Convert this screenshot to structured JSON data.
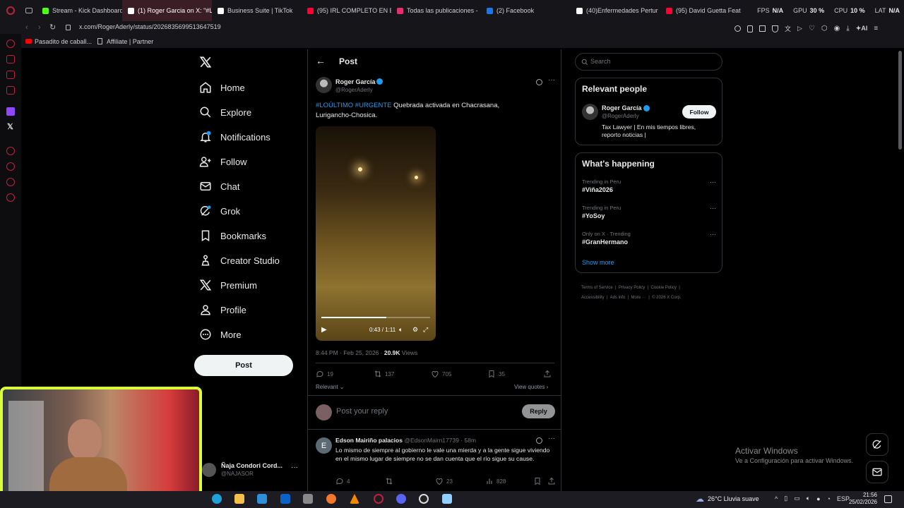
{
  "browser": {
    "tabs": [
      {
        "label": "Stream - Kick Dashboard",
        "color": "#53fc18"
      },
      {
        "label": "(1) Roger Garcia on X: \"#L",
        "color": "#ffffff",
        "active": true
      },
      {
        "label": "Business Suite | TikTok",
        "color": "#ffffff"
      },
      {
        "label": "(95) IRL COMPLETO EN E",
        "color": "#ff0033"
      },
      {
        "label": "Todas las publicaciones -",
        "color": "#e1306c"
      },
      {
        "label": "(2) Facebook",
        "color": "#1877f2"
      },
      {
        "label": "(40)Enfermedades Pertur",
        "color": "#ffffff"
      },
      {
        "label": "(95) David Guetta Feat",
        "color": "#ff0033"
      }
    ],
    "stats": {
      "fps_label": "FPS",
      "fps_value": "N/A",
      "gpu_label": "GPU",
      "gpu_value": "30 %",
      "cpu_label": "CPU",
      "cpu_value": "10 %",
      "lat_label": "LAT",
      "lat_value": "N/A"
    },
    "url": "x.com/RogerAderly/status/2026835699513647519",
    "ai_label": "AI",
    "bookmarks": [
      {
        "label": "Pasadito de caball..."
      },
      {
        "label": "Affiliate | Partner"
      }
    ]
  },
  "nav": {
    "items": [
      {
        "label": "Home",
        "icon": "home-icon"
      },
      {
        "label": "Explore",
        "icon": "search-icon"
      },
      {
        "label": "Notifications",
        "icon": "bell-icon"
      },
      {
        "label": "Follow",
        "icon": "person-plus-icon"
      },
      {
        "label": "Chat",
        "icon": "mail-icon"
      },
      {
        "label": "Grok",
        "icon": "grok-icon"
      },
      {
        "label": "Bookmarks",
        "icon": "bookmark-icon"
      },
      {
        "label": "Creator Studio",
        "icon": "creator-icon"
      },
      {
        "label": "Premium",
        "icon": "x-icon"
      },
      {
        "label": "Profile",
        "icon": "person-icon"
      },
      {
        "label": "More",
        "icon": "more-circle-icon"
      }
    ],
    "post_button": "Post",
    "account": {
      "name": "Ñaja Condori Cord...",
      "handle": "@NAJASOR"
    }
  },
  "post": {
    "header": "Post",
    "author": {
      "name": "Roger García",
      "handle": "@RogerAderly"
    },
    "text_tags": "#LOÚLTIMO #URGENTE",
    "text_body": " Quebrada activada en Chacrasana, Lurigancho-Chosica.",
    "video": {
      "time": "0:43 / 1:11",
      "progress": 0.6
    },
    "timestamp": "8:44 PM · Feb 25, 2026 · ",
    "views_count": "20.9K",
    "views_label": " Views",
    "replies": "19",
    "reposts": "137",
    "likes": "705",
    "bookmarks": "35",
    "sort_label": "Relevant",
    "view_quotes": "View quotes",
    "reply_placeholder": "Post your reply",
    "reply_button": "Reply"
  },
  "reply": {
    "avatar_letter": "E",
    "name": "Edson Mairiño palacios",
    "handle": "@EdsonMairn17739",
    "time": " · 58m",
    "text": "Lo mismo de siempre al gobierno le vale una mierda y a la gente sigue viviendo en el mismo lugar de siempre no se dan cuenta que el río sigue su cause.",
    "replies": "4",
    "likes": "23",
    "views": "828"
  },
  "right": {
    "search_placeholder": "Search",
    "relevant_title": "Relevant people",
    "person": {
      "name": "Roger García",
      "handle": "@RogerAderly",
      "bio": "Tax Lawyer | En mis tiempos libres, reporto noticias |",
      "follow": "Follow"
    },
    "happening_title": "What's happening",
    "trends": [
      {
        "meta": "Trending in Peru",
        "tag": "#Viña2026"
      },
      {
        "meta": "Trending in Peru",
        "tag": "#YoSoy"
      },
      {
        "meta": "Only on X · Trending",
        "tag": "#GranHermano"
      }
    ],
    "show_more": "Show more",
    "footer_line1": [
      "Terms of Service",
      "Privacy Policy",
      "Cookie Policy"
    ],
    "footer_line2": [
      "Accessibility",
      "Ads info",
      "More ···",
      "© 2026 X Corp."
    ]
  },
  "windows": {
    "activate_title": "Activar Windows",
    "activate_sub": "Ve a Configuración para activar Windows.",
    "weather": "26°C  Lluvia suave",
    "lang": "ESP",
    "time": "21:56",
    "date": "25/02/2026"
  },
  "colors": {
    "accent": "#1d9bf0",
    "opera": "#c0203f",
    "webcam_border": "#d8ff3a"
  }
}
